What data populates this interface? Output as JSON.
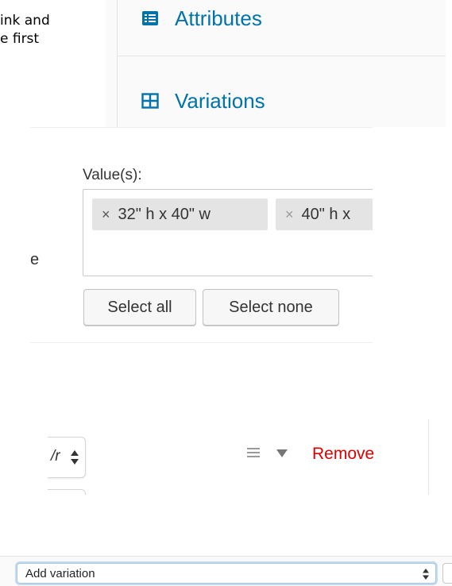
{
  "document": {
    "lines": [
      "ink and",
      "e first"
    ]
  },
  "product_tabs": {
    "items": [
      {
        "label": "Attributes",
        "icon": "list-icon"
      },
      {
        "label": "Variations",
        "icon": "grid-icon"
      }
    ],
    "accent_color": "#0073aa"
  },
  "attribute_values": {
    "row_label": "ge",
    "values_label": "Value(s):",
    "chips": [
      {
        "remove_glyph": "×",
        "text": "32\" h x 40\" w"
      },
      {
        "remove_glyph": "×",
        "text": "40\" h x"
      }
    ],
    "select_all_label": "Select all",
    "select_none_label": "Select none"
  },
  "variation_row": {
    "select_value": "/r",
    "remove_label": "Remove",
    "remove_color": "#dd0000"
  },
  "variations_toolbar": {
    "select_value": "Add variation",
    "focus_color": "#5b9dd9"
  }
}
